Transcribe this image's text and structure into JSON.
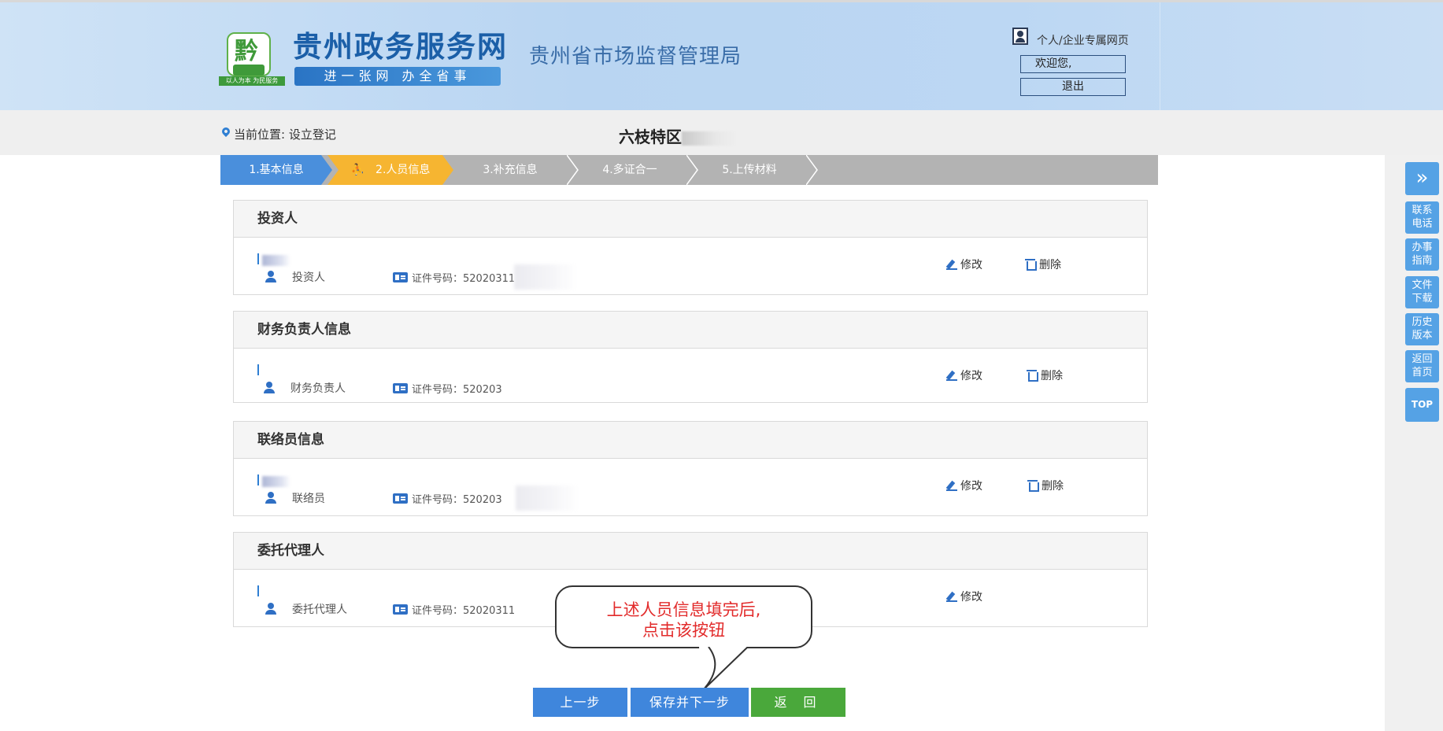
{
  "header": {
    "site_title": "贵州政务服务网",
    "site_slogan": "进一张网 办全省事",
    "logo_text": "黔",
    "logo_tagline": "以人为本 为民服务",
    "bureau": "贵州省市场监督管理局",
    "user_link": "个人/企业专属网页",
    "welcome_label": "欢迎您,",
    "logout_label": "退出"
  },
  "breadcrumb": {
    "label": "当前位置: 设立登记",
    "company_prefix": "六枝特区"
  },
  "steps": [
    {
      "label": "1.基本信息",
      "state": "done"
    },
    {
      "label": "2.人员信息",
      "state": "active"
    },
    {
      "label": "3.补充信息",
      "state": "todo"
    },
    {
      "label": "4.多证合一",
      "state": "todo"
    },
    {
      "label": "5.上传材料",
      "state": "todo"
    }
  ],
  "sections": [
    {
      "title": "投资人",
      "role": "投资人",
      "id_label": "证件号码：52020311",
      "edit": "修改",
      "delete": "删除"
    },
    {
      "title": "财务负责人信息",
      "role": "财务负责人",
      "id_label": "证件号码：520203",
      "edit": "修改",
      "delete": "删除"
    },
    {
      "title": "联络员信息",
      "role": "联络员",
      "id_label": "证件号码：520203",
      "edit": "修改",
      "delete": "删除"
    },
    {
      "title": "委托代理人",
      "role": "委托代理人",
      "id_label": "证件号码：52020311",
      "edit": "修改"
    }
  ],
  "callout": {
    "line1": "上述人员信息填完后,",
    "line2": "点击该按钮"
  },
  "buttons": {
    "prev": "上一步",
    "save_next": "保存并下一步",
    "back": "返 回"
  },
  "sidebar": {
    "expand": "»",
    "items": [
      "联系电话",
      "办事指南",
      "文件下载",
      "历史版本",
      "返回首页"
    ],
    "top": "TOP"
  },
  "colors": {
    "primary": "#3f86dc",
    "active_step": "#f6b531",
    "back_button": "#4aa83b",
    "callout_text": "#e22b2b"
  }
}
